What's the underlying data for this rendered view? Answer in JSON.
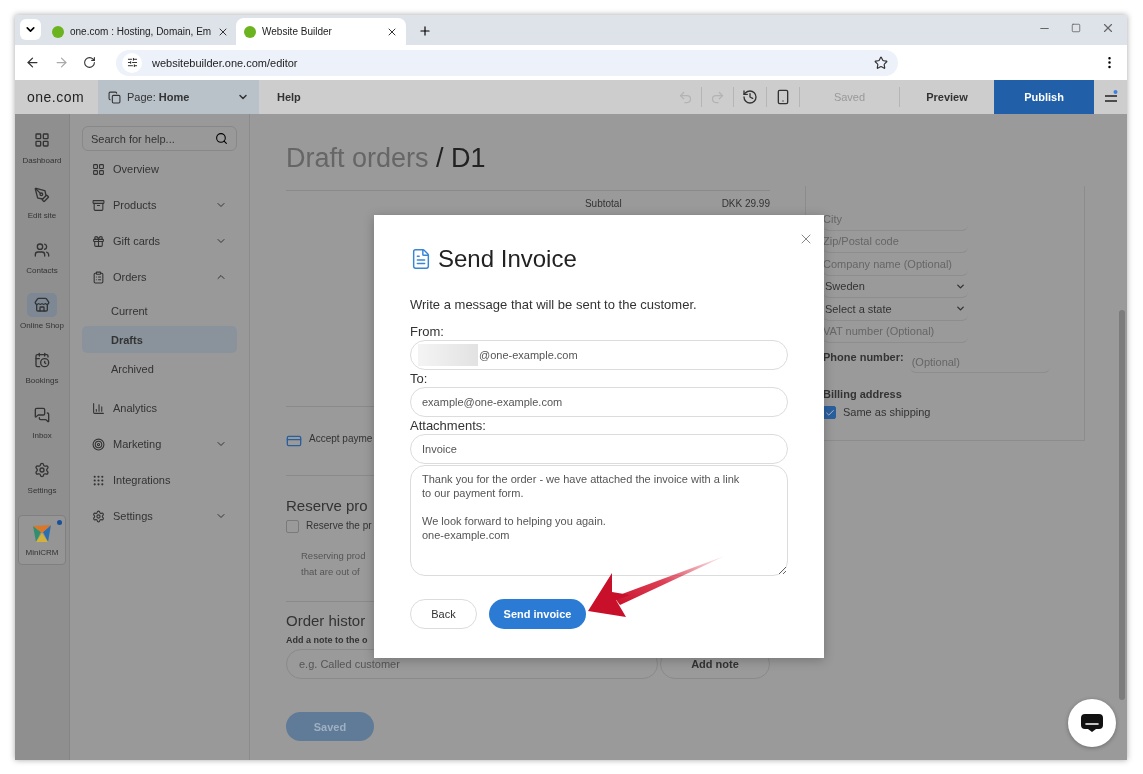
{
  "browser": {
    "tabs": [
      {
        "title": "one.com : Hosting, Domain, Em",
        "selected": false
      },
      {
        "title": "Website Builder",
        "selected": true
      }
    ],
    "url": "websitebuilder.one.com/editor"
  },
  "topbar": {
    "logo": "one.com",
    "page": "Page: **Home**",
    "help": "Help",
    "status": "Saved",
    "preview": "Preview",
    "publish": "Publish"
  },
  "rail": [
    {
      "label": "Dashboard",
      "selected": false
    },
    {
      "label": "Edit site",
      "selected": false
    },
    {
      "label": "Contacts",
      "selected": false
    },
    {
      "label": "Online Shop",
      "selected": true
    },
    {
      "label": "Bookings",
      "selected": false
    },
    {
      "label": "Inbox",
      "selected": false
    },
    {
      "label": "Settings",
      "selected": false
    }
  ],
  "minicrm": {
    "label": "MiniCRM",
    "notification": true
  },
  "sidebar": {
    "search_placeholder": "Search for help...",
    "items": [
      {
        "label": "Overview",
        "kind": "link"
      },
      {
        "label": "Products",
        "kind": "group",
        "expanded": false
      },
      {
        "label": "Gift cards",
        "kind": "group",
        "expanded": false
      },
      {
        "label": "Orders",
        "kind": "group",
        "expanded": true,
        "children": [
          {
            "label": "Current",
            "selected": false
          },
          {
            "label": "Drafts",
            "selected": true
          },
          {
            "label": "Archived",
            "selected": false
          }
        ]
      },
      {
        "label": "Analytics",
        "kind": "link"
      },
      {
        "label": "Marketing",
        "kind": "group",
        "expanded": false
      },
      {
        "label": "Integrations",
        "kind": "link"
      },
      {
        "label": "Settings",
        "kind": "group",
        "expanded": false
      }
    ]
  },
  "page": {
    "breadcrumb": "Draft orders",
    "title": "/ D1",
    "subtotal_label": "Subtotal",
    "subtotal_value": "DKK 29.99",
    "payment": "Accept payme",
    "reserve_heading": "Reserve pro",
    "reserve_checkbox": {
      "label": "Reserve the pr",
      "checked": false
    },
    "reserve_note": [
      "Reserving prod",
      "that are out of"
    ],
    "history_heading": "Order histor",
    "note_label": "Add a note to the o",
    "note_placeholder": "e.g. Called customer",
    "add_note": "Add note",
    "save": "Saved"
  },
  "address_form": {
    "fields": [
      {
        "kind": "input",
        "placeholder": "City"
      },
      {
        "kind": "input",
        "placeholder": "Zip/Postal code"
      },
      {
        "kind": "input",
        "placeholder": "Company name (Optional)"
      },
      {
        "kind": "select",
        "value": "Sweden"
      },
      {
        "kind": "select",
        "value": "Select a state"
      },
      {
        "kind": "input",
        "placeholder": "VAT number (Optional)"
      },
      {
        "kind": "phone",
        "label": "Phone number:",
        "placeholder": "(Optional)"
      }
    ],
    "billing_heading": "Billing address",
    "same_as_shipping": {
      "label": "Same as shipping",
      "checked": true
    }
  },
  "dialog": {
    "title": "Send Invoice",
    "intro": "Write a message that will be sent to the customer.",
    "from_label": "From:",
    "from_value": "@one-example.com",
    "to_label": "To:",
    "to_value": "example@one-example.com",
    "attachments_label": "Attachments:",
    "attachment": "Invoice",
    "message": "Thank you for the order - we have attached the invoice with a link to our payment form.\n\nWe look forward to helping you again.\none-example.com",
    "back": "Back",
    "send": "Send invoice"
  }
}
